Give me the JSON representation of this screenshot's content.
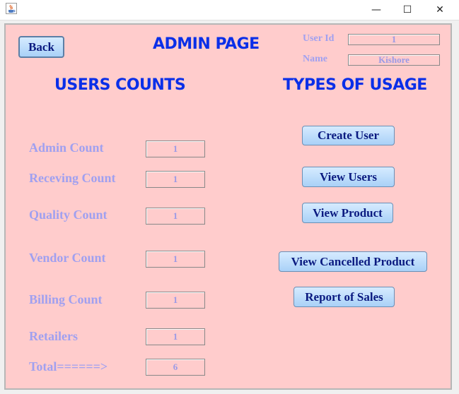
{
  "window": {
    "icon": "java-cup-icon",
    "minimize_glyph": "—",
    "maximize_glyph": "☐",
    "close_glyph": "✕"
  },
  "header": {
    "back_label": "Back",
    "title": "ADMIN PAGE",
    "user_id_label": "User Id",
    "user_id_value": "1",
    "name_label": "Name",
    "name_value": "Kishore"
  },
  "counts": {
    "heading": "USERS COUNTS",
    "rows": [
      {
        "label": "Admin Count",
        "value": "1"
      },
      {
        "label": "Receving Count",
        "value": "1"
      },
      {
        "label": "Quality Count",
        "value": "1"
      },
      {
        "label": "Vendor Count",
        "value": "1"
      },
      {
        "label": "Billing Count",
        "value": "1"
      },
      {
        "label": "Retailers",
        "value": "1"
      },
      {
        "label": "Total======>",
        "value": "6"
      }
    ]
  },
  "usage": {
    "heading": "TYPES OF USAGE",
    "buttons": [
      {
        "label": "Create User"
      },
      {
        "label": "View Users"
      },
      {
        "label": "View Product"
      },
      {
        "label": "View Cancelled Product"
      },
      {
        "label": "Report of Sales"
      }
    ]
  },
  "colors": {
    "background": "#ffcccc",
    "heading": "#0a2fe8",
    "label": "#a0a0f0",
    "button_text": "#0a1a80"
  }
}
